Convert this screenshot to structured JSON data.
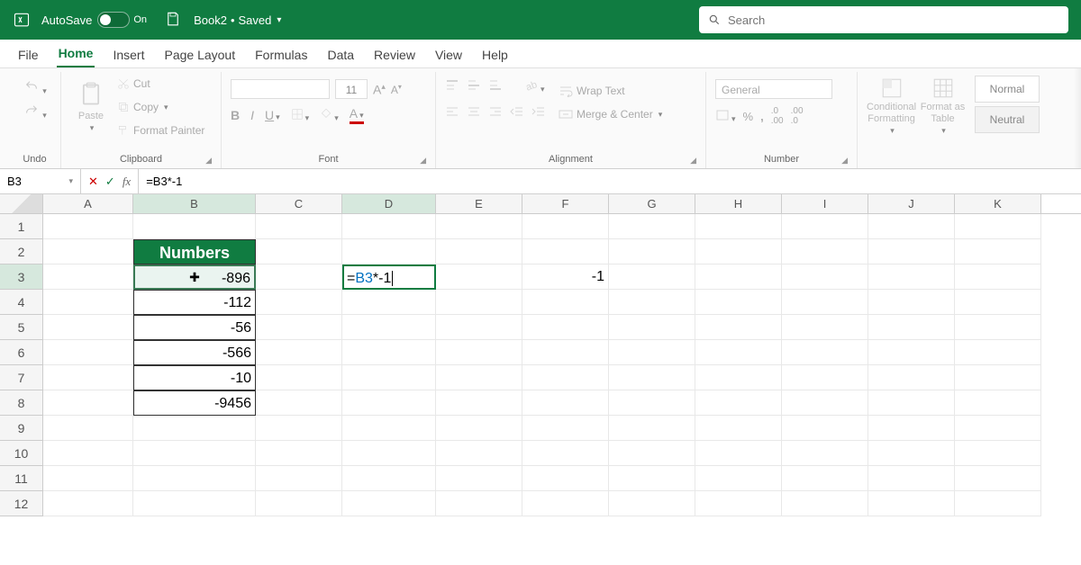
{
  "titlebar": {
    "autosave_label": "AutoSave",
    "autosave_on": "On",
    "doc_name": "Book2",
    "saved_label": "Saved",
    "search_placeholder": "Search"
  },
  "tabs": [
    "File",
    "Home",
    "Insert",
    "Page Layout",
    "Formulas",
    "Data",
    "Review",
    "View",
    "Help"
  ],
  "active_tab": "Home",
  "ribbon": {
    "undo_label": "Undo",
    "clipboard": {
      "label": "Clipboard",
      "paste": "Paste",
      "cut": "Cut",
      "copy": "Copy",
      "fmt": "Format Painter"
    },
    "font": {
      "label": "Font",
      "size": "11"
    },
    "alignment": {
      "label": "Alignment",
      "wrap": "Wrap Text",
      "merge": "Merge & Center"
    },
    "number": {
      "label": "Number",
      "format": "General"
    },
    "cond": "Conditional Formatting",
    "fmt_table": "Format as Table",
    "styles": {
      "normal": "Normal",
      "neutral": "Neutral"
    }
  },
  "formula_bar": {
    "namebox": "B3",
    "formula": "=B3*-1"
  },
  "columns": [
    {
      "l": "A",
      "w": 100
    },
    {
      "l": "B",
      "w": 136,
      "active": true
    },
    {
      "l": "C",
      "w": 96
    },
    {
      "l": "D",
      "w": 104,
      "active": true
    },
    {
      "l": "E",
      "w": 96
    },
    {
      "l": "F",
      "w": 96
    },
    {
      "l": "G",
      "w": 96
    },
    {
      "l": "H",
      "w": 96
    },
    {
      "l": "I",
      "w": 96
    },
    {
      "l": "J",
      "w": 96
    },
    {
      "l": "K",
      "w": 96
    }
  ],
  "row_count": 12,
  "active_rows": [
    3
  ],
  "cells": {
    "B2": {
      "v": "Numbers",
      "cls": "head"
    },
    "B3": {
      "v": "-896",
      "cls": "data ref",
      "cursor": true
    },
    "B4": {
      "v": "-112",
      "cls": "data"
    },
    "B5": {
      "v": "-56",
      "cls": "data"
    },
    "B6": {
      "v": "-566",
      "cls": "data"
    },
    "B7": {
      "v": "-10",
      "cls": "data"
    },
    "B8": {
      "v": "-9456",
      "cls": "data"
    },
    "D3": {
      "v": "",
      "cls": "editing",
      "editing_html": true
    },
    "F3": {
      "v": "-1"
    }
  },
  "editing_formula": {
    "ref": "B3",
    "rest": "*-1"
  }
}
